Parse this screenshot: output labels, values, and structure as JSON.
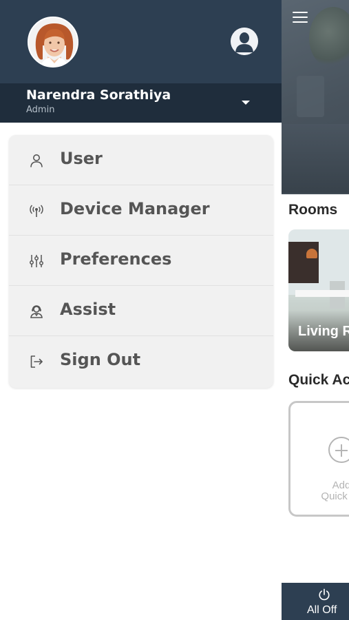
{
  "drawer": {
    "user_name": "Narendra Sorathiya",
    "user_role": "Admin",
    "menu": [
      {
        "label": "User",
        "icon": "user-icon"
      },
      {
        "label": "Device Manager",
        "icon": "antenna-icon"
      },
      {
        "label": "Preferences",
        "icon": "sliders-icon"
      },
      {
        "label": "Assist",
        "icon": "support-agent-icon"
      },
      {
        "label": "Sign Out",
        "icon": "sign-out-icon"
      }
    ]
  },
  "main": {
    "rooms_title": "Rooms",
    "room_card_label": "Living R",
    "quick_actions_title": "Quick Ac",
    "add_quick_action_line1": "Add",
    "add_quick_action_line2": "Quick Ac",
    "all_off_label": "All Off"
  },
  "colors": {
    "header": "#2d3f52",
    "user_bar": "#1f2d3c",
    "menu_bg": "#f1f1f1",
    "menu_text": "#555555"
  }
}
